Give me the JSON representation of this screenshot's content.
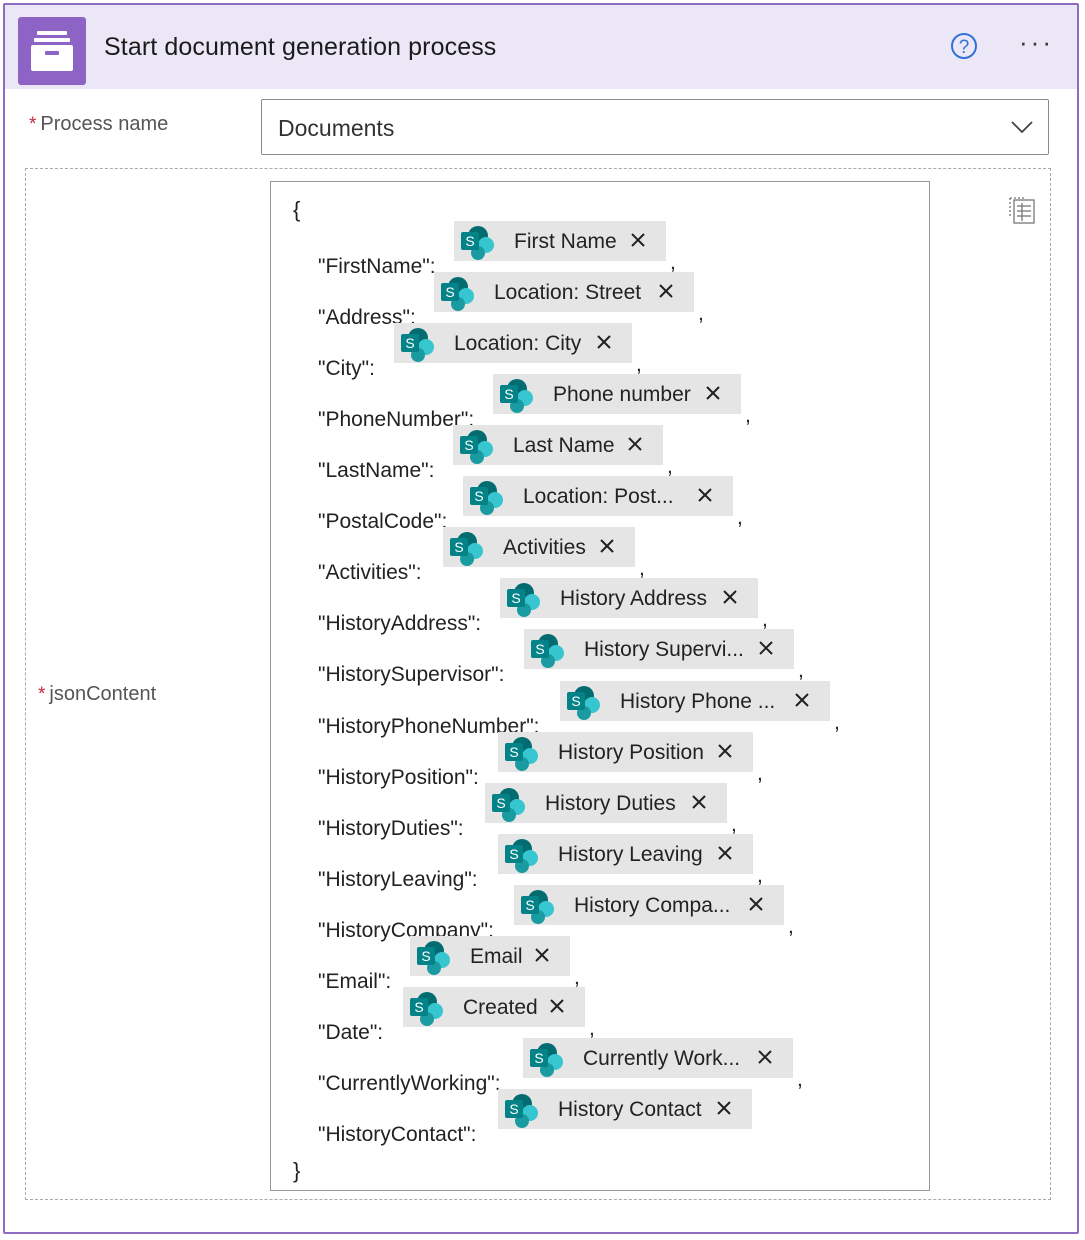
{
  "header": {
    "title": "Start document generation process",
    "icon": "file-cabinet-icon",
    "help_label": "?",
    "more_label": "···",
    "accent": "#8d64c6"
  },
  "process_name": {
    "label": "Process name",
    "value": "Documents",
    "required_mark": "*"
  },
  "json_content": {
    "label": "jsonContent",
    "required_mark": "*",
    "open_brace": "{",
    "close_brace": "}",
    "rows": [
      {
        "key": "\"FirstName\":",
        "token": "First Name",
        "comma": ","
      },
      {
        "key": "\"Address\":",
        "token": "Location: Street",
        "comma": ","
      },
      {
        "key": "\"City\":",
        "token": "Location: City",
        "comma": ","
      },
      {
        "key": "\"PhoneNumber\":",
        "token": "Phone number",
        "comma": ","
      },
      {
        "key": "\"LastName\":",
        "token": "Last Name",
        "comma": ","
      },
      {
        "key": "\"PostalCode\":",
        "token": "Location: Post...",
        "comma": ","
      },
      {
        "key": "\"Activities\":",
        "token": "Activities",
        "comma": ","
      },
      {
        "key": "\"HistoryAddress\":",
        "token": "History Address",
        "comma": ","
      },
      {
        "key": "\"HistorySupervisor\":",
        "token": "History Supervi...",
        "comma": ","
      },
      {
        "key": "\"HistoryPhoneNumber\":",
        "token": "History Phone ...",
        "comma": ","
      },
      {
        "key": "\"HistoryPosition\":",
        "token": "History Position",
        "comma": ","
      },
      {
        "key": "\"HistoryDuties\":",
        "token": "History Duties",
        "comma": ","
      },
      {
        "key": "\"HistoryLeaving\":",
        "token": "History Leaving",
        "comma": ","
      },
      {
        "key": "\"HistoryCompany\":",
        "token": "History Compa...",
        "comma": ","
      },
      {
        "key": "\"Email\":",
        "token": "Email",
        "comma": ","
      },
      {
        "key": "\"Date\":",
        "token": "Created",
        "comma": ","
      },
      {
        "key": "\"CurrentlyWorking\":",
        "token": "Currently Work...",
        "comma": ","
      },
      {
        "key": "\"HistoryContact\":",
        "token": "History Contact",
        "comma": ""
      }
    ]
  }
}
